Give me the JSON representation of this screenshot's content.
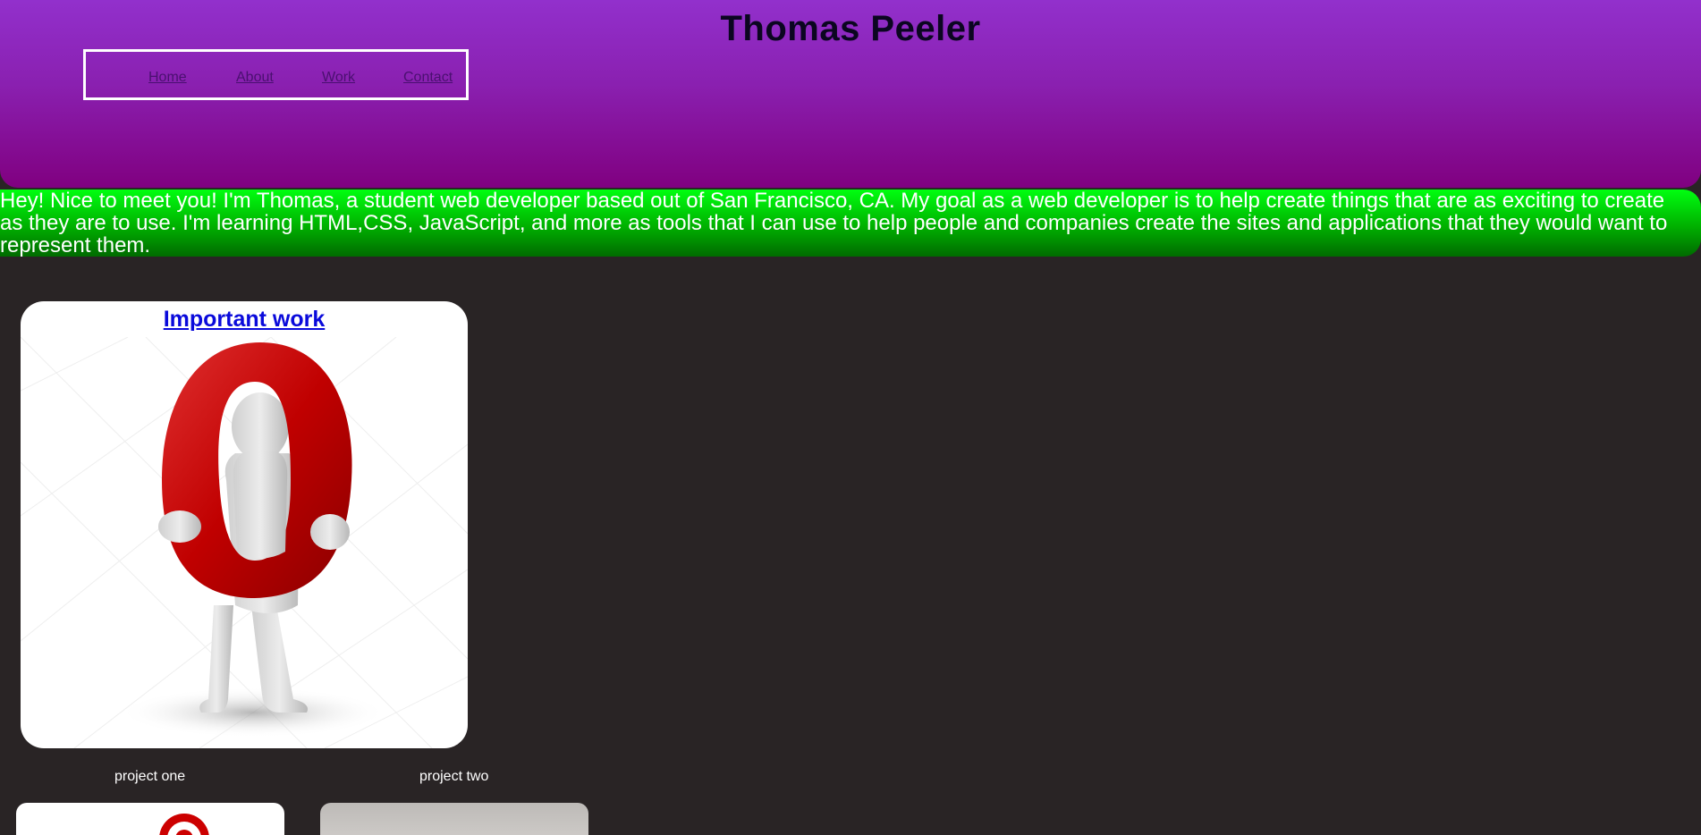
{
  "header": {
    "title": "Thomas Peeler",
    "nav": [
      "Home",
      "About",
      "Work",
      "Contact"
    ]
  },
  "intro": {
    "text": "Hey! Nice to meet you! I'm Thomas, a student web developer based out of San Francisco, CA. My goal as a web developer is to help create things that are as exciting to create as they are to use. I'm learning HTML,CSS, JavaScript, and more as tools that I can use to help people and companies create the sites and applications that they would want to represent them."
  },
  "work": {
    "title": "Important work",
    "image_icon": "figure-holding-letter-o-icon"
  },
  "projects": [
    {
      "label": "project one",
      "thumb_icon": "target-logo-icon"
    },
    {
      "label": "project two",
      "thumb_icon": "gray-photo-thumbnail"
    }
  ],
  "colors": {
    "header_top": "#9230cc",
    "header_bottom": "#800080",
    "intro_top": "#00ff10",
    "intro_bottom": "#006b00",
    "background": "#292425",
    "link": "#0a0adb"
  }
}
